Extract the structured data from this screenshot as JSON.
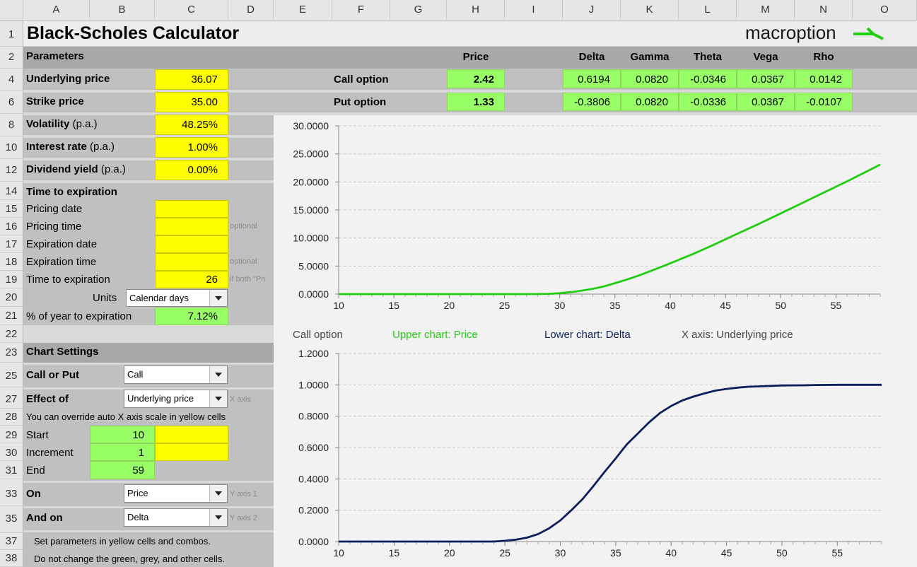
{
  "columns": [
    "A",
    "B",
    "C",
    "D",
    "E",
    "F",
    "G",
    "H",
    "I",
    "J",
    "K",
    "L",
    "M",
    "N",
    "O"
  ],
  "rows": [
    "1",
    "2",
    "4",
    "6",
    "8",
    "10",
    "12",
    "14",
    "15",
    "16",
    "17",
    "18",
    "19",
    "20",
    "21",
    "22",
    "23",
    "25",
    "27",
    "28",
    "29",
    "30",
    "31",
    "33",
    "35",
    "37",
    "38"
  ],
  "title": "Black-Scholes Calculator",
  "logo": "macroption",
  "params": {
    "header": "Parameters",
    "underlying": {
      "label": "Underlying price",
      "value": "36.07"
    },
    "strike": {
      "label": "Strike price",
      "value": "35.00"
    },
    "volatility": {
      "label": "Volatility",
      "suffix": "(p.a.)",
      "value": "48.25%"
    },
    "interest": {
      "label": "Interest rate",
      "suffix": "(p.a.)",
      "value": "1.00%"
    },
    "dividend": {
      "label": "Dividend yield",
      "suffix": "(p.a.)",
      "value": "0.00%"
    }
  },
  "tte": {
    "header": "Time to expiration",
    "pricing_date": {
      "label": "Pricing date",
      "value": ""
    },
    "pricing_time": {
      "label": "Pricing time",
      "value": "",
      "hint": "optional"
    },
    "expiration_date": {
      "label": "Expiration date",
      "value": ""
    },
    "expiration_time": {
      "label": "Expiration time",
      "value": "",
      "hint": "optional"
    },
    "time_to_exp": {
      "label": "Time to expiration",
      "value": "26",
      "hint": "if both \"Pri"
    },
    "units": {
      "label": "Units",
      "value": "Calendar days"
    },
    "pct_year": {
      "label": "% of year to expiration",
      "value": "7.12%"
    }
  },
  "chart_settings": {
    "header": "Chart Settings",
    "call_put": {
      "label": "Call or Put",
      "value": "Call"
    },
    "effect_of": {
      "label": "Effect of",
      "value": "Underlying price",
      "hint": "X axis"
    },
    "override_note": "You can override auto X axis scale in yellow cells",
    "start": {
      "label": "Start",
      "value": "10",
      "override": ""
    },
    "increment": {
      "label": "Increment",
      "value": "1",
      "override": ""
    },
    "end": {
      "label": "End",
      "value": "59"
    },
    "on": {
      "label": "On",
      "value": "Price",
      "hint": "Y axis 1"
    },
    "and_on": {
      "label": "And on",
      "value": "Delta",
      "hint": "Y axis 2"
    },
    "note1": "Set parameters in yellow cells and combos.",
    "note2": "Do not change the green, grey, and other cells."
  },
  "results": {
    "headers": {
      "price": "Price",
      "delta": "Delta",
      "gamma": "Gamma",
      "theta": "Theta",
      "vega": "Vega",
      "rho": "Rho"
    },
    "call": {
      "label": "Call option",
      "price": "2.42",
      "delta": "0.6194",
      "gamma": "0.0820",
      "theta": "-0.0346",
      "vega": "0.0367",
      "rho": "0.0142"
    },
    "put": {
      "label": "Put option",
      "price": "1.33",
      "delta": "-0.3806",
      "gamma": "0.0820",
      "theta": "-0.0336",
      "vega": "0.0367",
      "rho": "-0.0107"
    }
  },
  "chart_legend": {
    "option": "Call option",
    "upper": "Upper chart: Price",
    "lower": "Lower chart: Delta",
    "xaxis": "X axis: Underlying price"
  },
  "colors": {
    "price_line": "#22cc11",
    "delta_line": "#0c1e5c",
    "yellow": "#ffff00",
    "green": "#99ff66"
  },
  "chart_data": [
    {
      "type": "line",
      "x": [
        10,
        14,
        18,
        22,
        25,
        27,
        28,
        29,
        30,
        31,
        32,
        33,
        34,
        35,
        36,
        37,
        38,
        39,
        40,
        42,
        44,
        46,
        48,
        50,
        52,
        54,
        56,
        58,
        59
      ],
      "series": [
        {
          "values": [
            0,
            0,
            0,
            0,
            0,
            0,
            0.01,
            0.05,
            0.15,
            0.35,
            0.62,
            0.95,
            1.38,
            1.95,
            2.55,
            3.2,
            3.95,
            4.7,
            5.5,
            7.1,
            8.85,
            10.7,
            12.5,
            14.4,
            16.3,
            18.2,
            20.1,
            22.1,
            23.1
          ]
        }
      ],
      "xlim": [
        10,
        59
      ],
      "ylim": [
        0,
        30
      ],
      "xticks": [
        10,
        15,
        20,
        25,
        30,
        35,
        40,
        45,
        50,
        55
      ],
      "yticks": [
        "0.0000",
        "5.0000",
        "10.0000",
        "15.0000",
        "20.0000",
        "25.0000",
        "30.0000"
      ],
      "grid": true
    },
    {
      "type": "line",
      "x": [
        10,
        20,
        22,
        24,
        25,
        26,
        27,
        28,
        29,
        30,
        31,
        32,
        33,
        34,
        35,
        36,
        37,
        38,
        39,
        40,
        41,
        42,
        43,
        44,
        45,
        46,
        47,
        48,
        50,
        52,
        53,
        55,
        59
      ],
      "series": [
        {
          "values": [
            0,
            0,
            0,
            0,
            0.005,
            0.012,
            0.025,
            0.048,
            0.085,
            0.135,
            0.2,
            0.27,
            0.355,
            0.445,
            0.53,
            0.62,
            0.69,
            0.76,
            0.82,
            0.865,
            0.9,
            0.925,
            0.945,
            0.963,
            0.974,
            0.982,
            0.988,
            0.99,
            0.996,
            0.997,
            0.999,
            1.0,
            1.0
          ]
        }
      ],
      "xlim": [
        10,
        59
      ],
      "ylim": [
        0,
        1.2
      ],
      "xticks": [
        10,
        15,
        20,
        25,
        30,
        35,
        40,
        45,
        50,
        55
      ],
      "yticks": [
        "0.0000",
        "0.2000",
        "0.4000",
        "0.6000",
        "0.8000",
        "1.0000",
        "1.2000"
      ],
      "grid": true
    }
  ]
}
